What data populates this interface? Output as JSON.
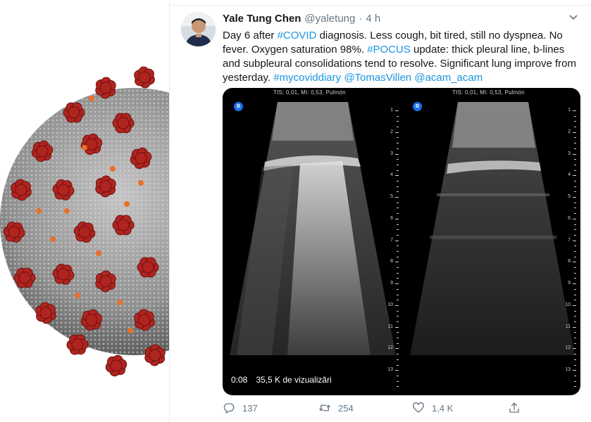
{
  "tweet": {
    "author_name": "Yale Tung Chen",
    "author_handle": "@yaletung",
    "separator": "·",
    "time": "4 h",
    "text_parts": [
      {
        "text": "Day 6 after ",
        "link": false
      },
      {
        "text": "#COVID",
        "link": true
      },
      {
        "text": " diagnosis. Less cough, bit tired, still no dyspnea. No fever. Oxygen saturation 98%. ",
        "link": false
      },
      {
        "text": "#POCUS",
        "link": true
      },
      {
        "text": " update: thick pleural line, b-lines and subpleural consolidations tend to resolve. Significant lung improve from yesterday. ",
        "link": false
      },
      {
        "text": "#mycoviddiary",
        "link": true
      },
      {
        "text": " ",
        "link": false
      },
      {
        "text": "@TomasVillen",
        "link": true
      },
      {
        "text": " ",
        "link": false
      },
      {
        "text": "@acam_acam",
        "link": true
      }
    ]
  },
  "media": {
    "scan_header": "TIS: 0,01, MI: 0,53, Pulmón",
    "badge": "B",
    "depth_ticks": [
      "1",
      "2",
      "3",
      "4",
      "5",
      "6",
      "7",
      "8",
      "9",
      "10",
      "11",
      "12",
      "13"
    ],
    "video_time": "0:08",
    "view_count": "35,5 K de vizualizări"
  },
  "actions": {
    "reply_count": "137",
    "retweet_count": "254",
    "like_count": "1,4 K"
  },
  "icons": {
    "reply": "reply-icon",
    "retweet": "retweet-icon",
    "like": "heart-icon",
    "share": "share-icon",
    "caret": "chevron-down-icon"
  },
  "colors": {
    "link": "#1b95e0",
    "secondary_text": "#657786",
    "primary_text": "#14171a",
    "virus_red": "#b0241f",
    "virus_gray": "#9a9a9a",
    "virus_orange": "#e8702a"
  }
}
